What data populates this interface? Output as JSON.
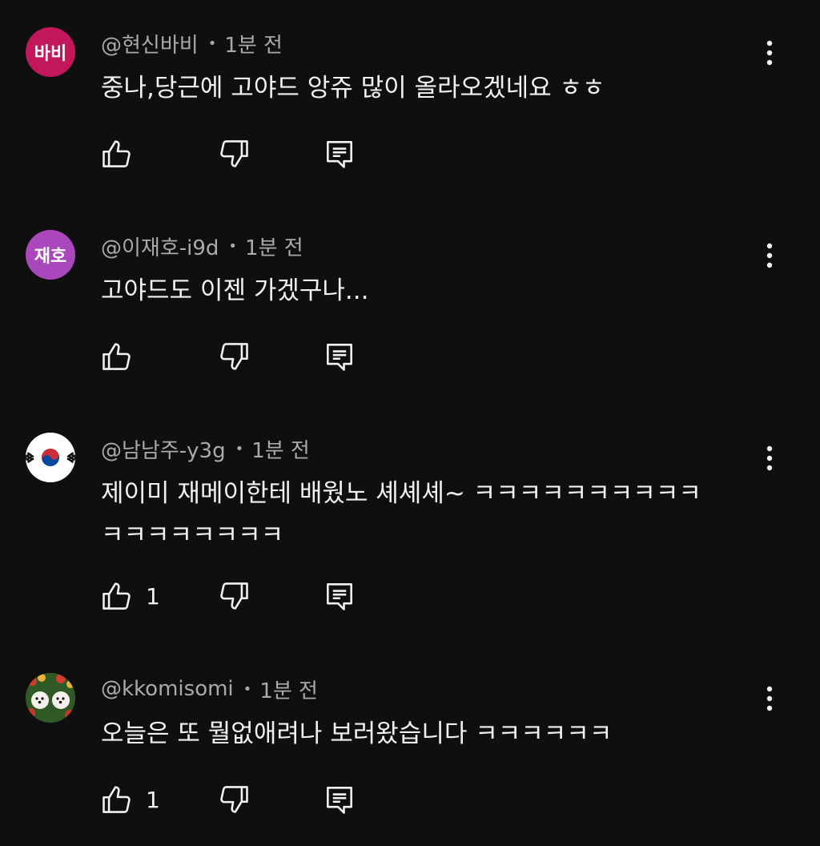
{
  "comments": [
    {
      "avatar_text": "바비",
      "avatar_color": "#c2185b",
      "author": "@현신바비",
      "time": "1분 전",
      "text": "중나,당근에 고야드 앙쥬 많이 올라오겠네요 ㅎㅎ",
      "likes": ""
    },
    {
      "avatar_text": "재호",
      "avatar_color": "#ab47bc",
      "author": "@이재호-i9d",
      "time": "1분 전",
      "text": "고야드도 이젠 가겠구나...",
      "likes": ""
    },
    {
      "avatar_text": "",
      "avatar_icon": "korea-flag-icon",
      "author": "@남남주-y3g",
      "time": "1분 전",
      "text": "제이미 재메이한테 배웠노 셰셰셰~ ㅋㅋㅋㅋㅋㅋㅋㅋㅋㅋ\nㅋㅋㅋㅋㅋㅋㅋㅋ",
      "likes": "1"
    },
    {
      "avatar_text": "",
      "avatar_icon": "dogs-photo-icon",
      "author": "@kkomisomi",
      "time": "1분 전",
      "text": "오늘은 또 뭘없애려나 보러왔습니다 ㅋㅋㅋㅋㅋㅋ",
      "likes": "1"
    }
  ],
  "icons": {
    "like": "thumb-up-icon",
    "dislike": "thumb-down-icon",
    "reply": "reply-comment-icon",
    "more": "more-vert-icon"
  },
  "colors": {
    "background": "#0f0f0f",
    "text": "#f1f1f1",
    "meta": "#aaaaaa"
  }
}
